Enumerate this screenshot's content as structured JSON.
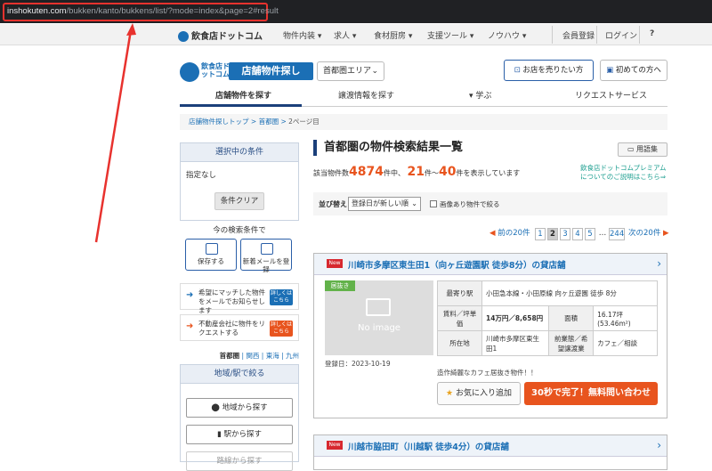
{
  "address_bar": {
    "url_host": "inshokuten.com",
    "url_path": "/bukken/kanto/bukkens/list/?mode=index&page=2#result"
  },
  "topnav": {
    "logo": "飲食店ドットコム",
    "menu": [
      "物件内装 ▾",
      "求人 ▾",
      "食材厨房 ▾",
      "支援ツール ▾",
      "ノウハウ ▾"
    ],
    "register": "会員登録",
    "login": "ログイン",
    "help": "?"
  },
  "header": {
    "brand": "飲食店ドットコム",
    "title": "店舗物件探し",
    "area_select": "首都圏エリア",
    "sell_button": "お店を売りたい方",
    "first_button": "初めての方へ",
    "nav": [
      "店舗物件を探す",
      "譲渡情報を探す",
      "学ぶ",
      "リクエストサービス"
    ]
  },
  "breadcrumb": {
    "items": [
      "店舗物件探しトップ",
      "首都圏"
    ],
    "sep": ">",
    "current": "2ページ目"
  },
  "sidebar": {
    "selected_title": "選択中の条件",
    "none": "指定なし",
    "clear_button": "条件クリア",
    "current_conditions": "今の検索条件で",
    "save_button": "保存する",
    "mail_button": "新着メールを登録",
    "promo1": "希望にマッチした物件をメールでお知らせします",
    "promo2": "不動産会社に物件をリクエストする",
    "detail_label": "詳しくはこちら",
    "regions": [
      "首都圏",
      "関西",
      "東海",
      "九州"
    ],
    "station_title": "地域/駅で絞る",
    "area_button": "地域から探す",
    "station_button": "駅から探す",
    "route_button": "路線から探す"
  },
  "results": {
    "title": "首都圏の物件検索結果一覧",
    "glossary": "用語集",
    "count_prefix": "該当物件数",
    "total": "4874",
    "count_mid": "件中、",
    "from": "21",
    "count_to": "件～",
    "to": "40",
    "count_suffix": "件を表示しています",
    "premium_link": "飲食店ドットコムプレミアムについてのご説明はこちら⇒",
    "sort_label": "並び替え",
    "sort_value": "登録日が新しい順",
    "image_only": "画像あり物件で絞る",
    "pager": {
      "prev": "前の20件",
      "pages": [
        "1",
        "2",
        "3",
        "4",
        "5",
        "…",
        "244"
      ],
      "current": "2",
      "next": "次の20件"
    }
  },
  "listings": [
    {
      "new_badge": "New",
      "title": "川崎市多摩区東生田1（向ヶ丘遊園駅 徒歩8分）の貸店舗",
      "tag": "居抜き",
      "no_image": "No image",
      "registered": "登録日：2023-10-19",
      "spec": [
        {
          "key": "最寄り駅",
          "value": "小田急本線・小田原線 向ヶ丘遊園 徒歩 8分"
        },
        {
          "key": "賃料／坪単価",
          "value": "14万円／8,658円",
          "key2": "面積",
          "value2": "16.17坪(53.46m²)"
        },
        {
          "key": "所在地",
          "value": "川崎市多摩区東生田1",
          "key2": "前業態／希望譲渡業",
          "value2": "カフェ／相談"
        }
      ],
      "description": "造作綺麗なカフェ居抜き物件！！",
      "fav_button": "お気に入り追加",
      "inquiry_button": "30秒で完了！無料問い合わせ"
    },
    {
      "new_badge": "New",
      "title": "川越市脇田町（川越駅 徒歩4分）の貸店舗"
    }
  ],
  "colors": {
    "accent": "#1b6fb5",
    "orange": "#e8541e",
    "annotation": "#e8322e"
  }
}
